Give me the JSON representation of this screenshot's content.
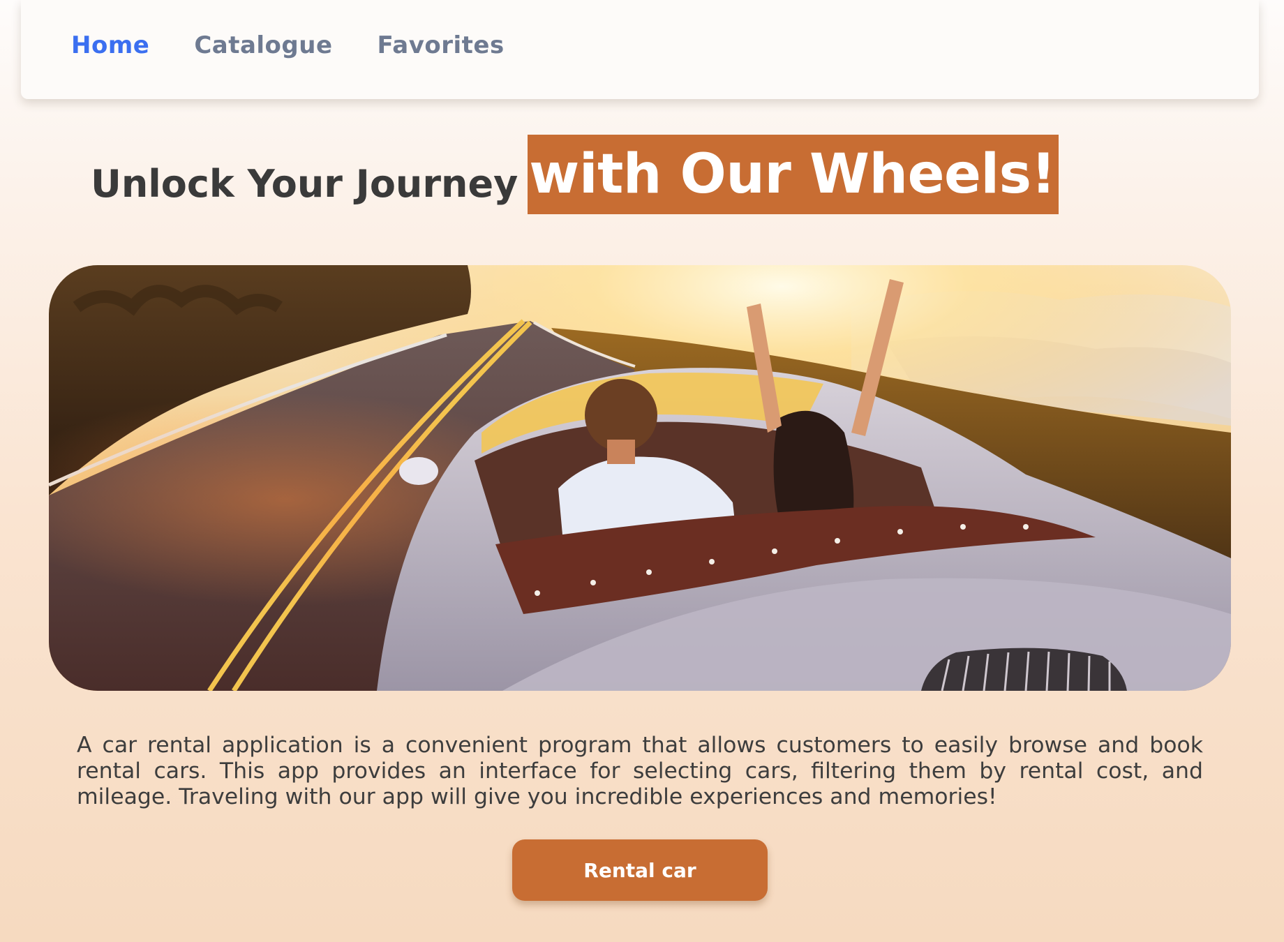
{
  "nav": {
    "items": [
      {
        "label": "Home",
        "active": true
      },
      {
        "label": "Catalogue",
        "active": false
      },
      {
        "label": "Favorites",
        "active": false
      }
    ]
  },
  "hero": {
    "headline_lead": "Unlock Your Journey",
    "headline_accent": "with Our Wheels!",
    "description": "A car rental application is a convenient program that allows customers to easily browse and book rental cars. This app provides an interface for selecting cars, filtering them by rental cost, and mileage. Traveling with our app will give you incredible experiences and memories!",
    "cta_label": "Rental car"
  },
  "colors": {
    "accent": "#c86d33",
    "nav_active": "#3b6ff0",
    "nav_inactive": "#6e7a91",
    "heading_text": "#3a3a3a"
  }
}
